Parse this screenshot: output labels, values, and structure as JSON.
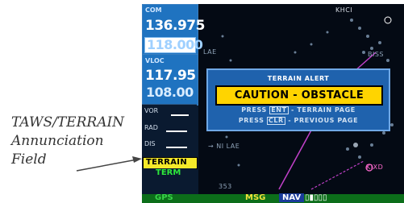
{
  "callout": {
    "line1": "TAWS/TERRAIN",
    "line2": "Annunciation",
    "line3": "Field"
  },
  "com": {
    "label": "COM",
    "active": "136.975",
    "standby": "118.000"
  },
  "vloc": {
    "label": "VLOC",
    "active": "117.95",
    "standby": "108.00"
  },
  "vor": {
    "label": "VOR",
    "rad_label": "RAD",
    "dis_label": "DIS"
  },
  "annunciator": {
    "terrain": "TERRAIN",
    "term": "TERM"
  },
  "bottom_bar": {
    "gps": "GPS",
    "msg": "MSG",
    "nav": "NAV",
    "indicator": "▯▮▯▯▯"
  },
  "map": {
    "labels": [
      "KHCI",
      "LAE",
      "BISS",
      "→ NI LAE",
      "KIXD",
      "353"
    ]
  },
  "alert": {
    "title": "TERRAIN ALERT",
    "message": "CAUTION - OBSTACLE",
    "press1": "PRESS",
    "key1": "ENT",
    "action1": "- TERRAIN PAGE",
    "press2": "PRESS",
    "key2": "CLR",
    "action2": "- PREVIOUS PAGE"
  },
  "colors": {
    "terrain_annunciation": "#f5e92a",
    "caution_banner": "#ffd400",
    "term_text": "#2eea3c",
    "popup_bg": "#1f62ad"
  }
}
